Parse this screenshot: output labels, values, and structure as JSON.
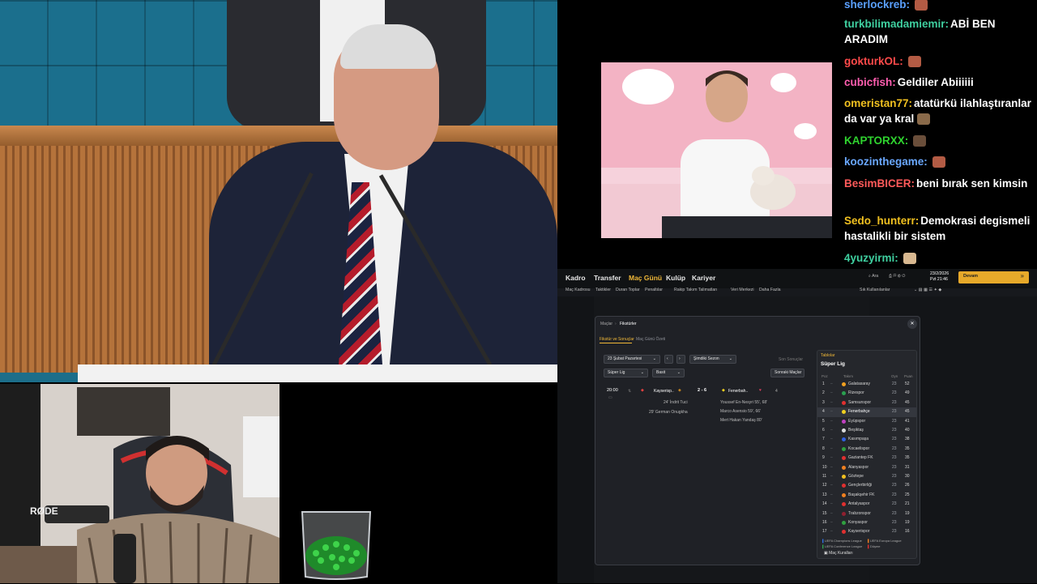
{
  "chat": {
    "messages": [
      {
        "user": "sherlockreb:",
        "text": "",
        "color": "#5aa0ff",
        "emote": "#b35b44"
      },
      {
        "user": "turkbilimadamiemir:",
        "text": "ABİ BEN ARADIM",
        "color": "#3fd0a0"
      },
      {
        "user": "gokturkOL:",
        "text": "",
        "color": "#ff4a4a",
        "emote": "#b35b44"
      },
      {
        "user": "cubicfish:",
        "text": "Geldiler Abiiiiii",
        "color": "#ff5eb0"
      },
      {
        "user": "omeristan77:",
        "text": "atatürkü ilahlaştıranlar da var ya kral",
        "color": "#f0c020",
        "emote": "#8a6a4a"
      },
      {
        "user": "KAPTORXX:",
        "text": "",
        "color": "#2fd42f",
        "emote": "#6a4e3a"
      },
      {
        "user": "koozinthegame:",
        "text": "",
        "color": "#6aa8ff",
        "emote": "#b35b44"
      },
      {
        "user": "BesimBICER:",
        "text": "beni bırak sen kimsin",
        "color": "#ff5a5a"
      },
      {
        "user": "Sedo_hunterr:",
        "text": "Demokrasi degismeli hastalikli bir sistem",
        "color": "#f0c020"
      },
      {
        "user": "4yuzyirmi:",
        "text": "",
        "color": "#3fd0a0",
        "emote": "#d8b890"
      }
    ]
  },
  "game": {
    "nav": [
      "Kadro",
      "Transfer",
      "Maç Günü",
      "Kulüp",
      "Kariyer"
    ],
    "subnav": [
      "Maç Kadrosu",
      "Taktikler",
      "Duran Toplar",
      "Penaltılar",
      "Rakip Takım Talimatları",
      "Veri Merkezi",
      "Daha Fazla"
    ],
    "date": "23/2/2026",
    "day_time": "Pzt 21:46",
    "search": "Ara",
    "continue": "Devam",
    "favorites": "Sık Kullanılanlar"
  },
  "modal": {
    "breadcrumb": [
      "Maçlar",
      "Fikstürler"
    ],
    "tabs": [
      "Fikstür ve Sonuçlar",
      "Maç Günü Özeti"
    ],
    "date_select": "23 Şubat Pazartesi",
    "season_select": "Şimdiki Sezon",
    "last_results": "Son Sonuçlar",
    "league_select": "Süper Lig",
    "view_select": "Basit",
    "next_matches": "Sonraki Maçlar",
    "match": {
      "time": "20:00",
      "home": "Kayserisp..",
      "score": "2 - 6",
      "away": "Fenerbah..",
      "away_num": "4",
      "home_goals": [
        "24' İndrit Tuci",
        "29' German Onugkha"
      ],
      "away_goals": [
        "Youssef En-Nesyri 55', 68'",
        "Marco Asensio 59', 66'",
        "Mert Hakan Yandaş 80'"
      ]
    },
    "standings": {
      "header": "Tablolar",
      "league": "Süper Lig",
      "cols": [
        "Poz",
        "Takım",
        "Oyn",
        "Puan"
      ],
      "rows": [
        {
          "pos": "1",
          "team": "Galatasaray",
          "pl": "23",
          "pts": "52",
          "color": "#f0a020",
          "active": false
        },
        {
          "pos": "2",
          "team": "Rizespor",
          "pl": "23",
          "pts": "49",
          "color": "#2aa050",
          "active": false
        },
        {
          "pos": "3",
          "team": "Samsunspor",
          "pl": "23",
          "pts": "45",
          "color": "#e03030",
          "active": false
        },
        {
          "pos": "4",
          "team": "Fenerbahçe",
          "pl": "23",
          "pts": "45",
          "color": "#f0d020",
          "active": true
        },
        {
          "pos": "5",
          "team": "Eyüpspor",
          "pl": "23",
          "pts": "41",
          "color": "#c040c0",
          "active": false
        },
        {
          "pos": "6",
          "team": "Beşiktaş",
          "pl": "23",
          "pts": "40",
          "color": "#dddddd",
          "active": false
        },
        {
          "pos": "7",
          "team": "Kasımpaşa",
          "pl": "23",
          "pts": "38",
          "color": "#3060e0",
          "active": false
        },
        {
          "pos": "8",
          "team": "Kocaelispor",
          "pl": "23",
          "pts": "35",
          "color": "#30a040",
          "active": false
        },
        {
          "pos": "9",
          "team": "Gaziantep FK",
          "pl": "23",
          "pts": "35",
          "color": "#e03030",
          "active": false
        },
        {
          "pos": "10",
          "team": "Alanyaspor",
          "pl": "23",
          "pts": "31",
          "color": "#f08020",
          "active": false
        },
        {
          "pos": "11",
          "team": "Göztepe",
          "pl": "23",
          "pts": "30",
          "color": "#f0c020",
          "active": false
        },
        {
          "pos": "12",
          "team": "Gençlerbirliği",
          "pl": "23",
          "pts": "26",
          "color": "#e03030",
          "active": false
        },
        {
          "pos": "13",
          "team": "Başakşehir FK",
          "pl": "23",
          "pts": "25",
          "color": "#f08020",
          "active": false
        },
        {
          "pos": "14",
          "team": "Antalyaspor",
          "pl": "23",
          "pts": "21",
          "color": "#e03030",
          "active": false
        },
        {
          "pos": "15",
          "team": "Trabzonspor",
          "pl": "23",
          "pts": "19",
          "color": "#902030",
          "active": false
        },
        {
          "pos": "16",
          "team": "Konyaspor",
          "pl": "23",
          "pts": "19",
          "color": "#30a040",
          "active": false
        },
        {
          "pos": "17",
          "team": "Kayserispor",
          "pl": "23",
          "pts": "16",
          "color": "#e03030",
          "active": false
        }
      ],
      "legend": [
        "UEFA Champions League",
        "UEFA Europa League",
        "UEFA Conference League",
        "Düşme"
      ],
      "rules": "Maç Kuralları"
    }
  },
  "webcam": {
    "mic_brand": "RØDE"
  }
}
